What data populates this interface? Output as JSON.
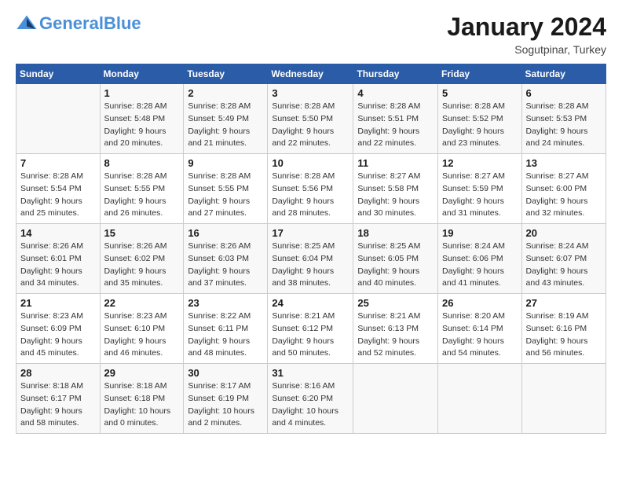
{
  "header": {
    "logo_general": "General",
    "logo_blue": "Blue",
    "month": "January 2024",
    "location": "Sogutpinar, Turkey"
  },
  "calendar": {
    "days_of_week": [
      "Sunday",
      "Monday",
      "Tuesday",
      "Wednesday",
      "Thursday",
      "Friday",
      "Saturday"
    ],
    "weeks": [
      [
        {
          "day": "",
          "detail": ""
        },
        {
          "day": "1",
          "detail": "Sunrise: 8:28 AM\nSunset: 5:48 PM\nDaylight: 9 hours\nand 20 minutes."
        },
        {
          "day": "2",
          "detail": "Sunrise: 8:28 AM\nSunset: 5:49 PM\nDaylight: 9 hours\nand 21 minutes."
        },
        {
          "day": "3",
          "detail": "Sunrise: 8:28 AM\nSunset: 5:50 PM\nDaylight: 9 hours\nand 22 minutes."
        },
        {
          "day": "4",
          "detail": "Sunrise: 8:28 AM\nSunset: 5:51 PM\nDaylight: 9 hours\nand 22 minutes."
        },
        {
          "day": "5",
          "detail": "Sunrise: 8:28 AM\nSunset: 5:52 PM\nDaylight: 9 hours\nand 23 minutes."
        },
        {
          "day": "6",
          "detail": "Sunrise: 8:28 AM\nSunset: 5:53 PM\nDaylight: 9 hours\nand 24 minutes."
        }
      ],
      [
        {
          "day": "7",
          "detail": "Sunrise: 8:28 AM\nSunset: 5:54 PM\nDaylight: 9 hours\nand 25 minutes."
        },
        {
          "day": "8",
          "detail": "Sunrise: 8:28 AM\nSunset: 5:55 PM\nDaylight: 9 hours\nand 26 minutes."
        },
        {
          "day": "9",
          "detail": "Sunrise: 8:28 AM\nSunset: 5:55 PM\nDaylight: 9 hours\nand 27 minutes."
        },
        {
          "day": "10",
          "detail": "Sunrise: 8:28 AM\nSunset: 5:56 PM\nDaylight: 9 hours\nand 28 minutes."
        },
        {
          "day": "11",
          "detail": "Sunrise: 8:27 AM\nSunset: 5:58 PM\nDaylight: 9 hours\nand 30 minutes."
        },
        {
          "day": "12",
          "detail": "Sunrise: 8:27 AM\nSunset: 5:59 PM\nDaylight: 9 hours\nand 31 minutes."
        },
        {
          "day": "13",
          "detail": "Sunrise: 8:27 AM\nSunset: 6:00 PM\nDaylight: 9 hours\nand 32 minutes."
        }
      ],
      [
        {
          "day": "14",
          "detail": "Sunrise: 8:26 AM\nSunset: 6:01 PM\nDaylight: 9 hours\nand 34 minutes."
        },
        {
          "day": "15",
          "detail": "Sunrise: 8:26 AM\nSunset: 6:02 PM\nDaylight: 9 hours\nand 35 minutes."
        },
        {
          "day": "16",
          "detail": "Sunrise: 8:26 AM\nSunset: 6:03 PM\nDaylight: 9 hours\nand 37 minutes."
        },
        {
          "day": "17",
          "detail": "Sunrise: 8:25 AM\nSunset: 6:04 PM\nDaylight: 9 hours\nand 38 minutes."
        },
        {
          "day": "18",
          "detail": "Sunrise: 8:25 AM\nSunset: 6:05 PM\nDaylight: 9 hours\nand 40 minutes."
        },
        {
          "day": "19",
          "detail": "Sunrise: 8:24 AM\nSunset: 6:06 PM\nDaylight: 9 hours\nand 41 minutes."
        },
        {
          "day": "20",
          "detail": "Sunrise: 8:24 AM\nSunset: 6:07 PM\nDaylight: 9 hours\nand 43 minutes."
        }
      ],
      [
        {
          "day": "21",
          "detail": "Sunrise: 8:23 AM\nSunset: 6:09 PM\nDaylight: 9 hours\nand 45 minutes."
        },
        {
          "day": "22",
          "detail": "Sunrise: 8:23 AM\nSunset: 6:10 PM\nDaylight: 9 hours\nand 46 minutes."
        },
        {
          "day": "23",
          "detail": "Sunrise: 8:22 AM\nSunset: 6:11 PM\nDaylight: 9 hours\nand 48 minutes."
        },
        {
          "day": "24",
          "detail": "Sunrise: 8:21 AM\nSunset: 6:12 PM\nDaylight: 9 hours\nand 50 minutes."
        },
        {
          "day": "25",
          "detail": "Sunrise: 8:21 AM\nSunset: 6:13 PM\nDaylight: 9 hours\nand 52 minutes."
        },
        {
          "day": "26",
          "detail": "Sunrise: 8:20 AM\nSunset: 6:14 PM\nDaylight: 9 hours\nand 54 minutes."
        },
        {
          "day": "27",
          "detail": "Sunrise: 8:19 AM\nSunset: 6:16 PM\nDaylight: 9 hours\nand 56 minutes."
        }
      ],
      [
        {
          "day": "28",
          "detail": "Sunrise: 8:18 AM\nSunset: 6:17 PM\nDaylight: 9 hours\nand 58 minutes."
        },
        {
          "day": "29",
          "detail": "Sunrise: 8:18 AM\nSunset: 6:18 PM\nDaylight: 10 hours\nand 0 minutes."
        },
        {
          "day": "30",
          "detail": "Sunrise: 8:17 AM\nSunset: 6:19 PM\nDaylight: 10 hours\nand 2 minutes."
        },
        {
          "day": "31",
          "detail": "Sunrise: 8:16 AM\nSunset: 6:20 PM\nDaylight: 10 hours\nand 4 minutes."
        },
        {
          "day": "",
          "detail": ""
        },
        {
          "day": "",
          "detail": ""
        },
        {
          "day": "",
          "detail": ""
        }
      ]
    ]
  }
}
